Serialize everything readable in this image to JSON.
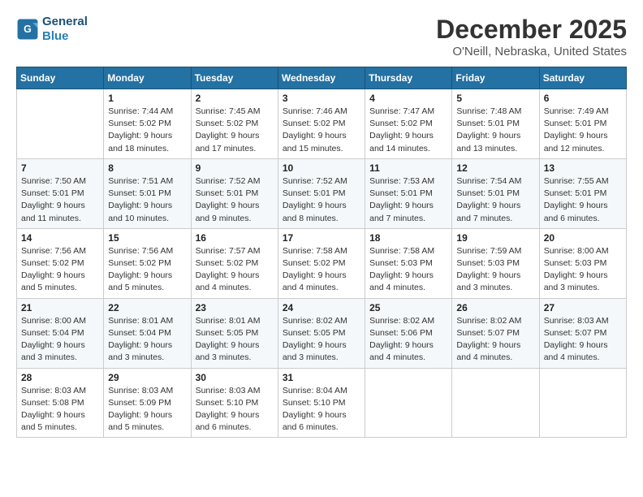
{
  "header": {
    "logo_line1": "General",
    "logo_line2": "Blue",
    "month_title": "December 2025",
    "location": "O'Neill, Nebraska, United States"
  },
  "weekdays": [
    "Sunday",
    "Monday",
    "Tuesday",
    "Wednesday",
    "Thursday",
    "Friday",
    "Saturday"
  ],
  "weeks": [
    [
      {
        "day": "",
        "info": ""
      },
      {
        "day": "1",
        "info": "Sunrise: 7:44 AM\nSunset: 5:02 PM\nDaylight: 9 hours\nand 18 minutes."
      },
      {
        "day": "2",
        "info": "Sunrise: 7:45 AM\nSunset: 5:02 PM\nDaylight: 9 hours\nand 17 minutes."
      },
      {
        "day": "3",
        "info": "Sunrise: 7:46 AM\nSunset: 5:02 PM\nDaylight: 9 hours\nand 15 minutes."
      },
      {
        "day": "4",
        "info": "Sunrise: 7:47 AM\nSunset: 5:02 PM\nDaylight: 9 hours\nand 14 minutes."
      },
      {
        "day": "5",
        "info": "Sunrise: 7:48 AM\nSunset: 5:01 PM\nDaylight: 9 hours\nand 13 minutes."
      },
      {
        "day": "6",
        "info": "Sunrise: 7:49 AM\nSunset: 5:01 PM\nDaylight: 9 hours\nand 12 minutes."
      }
    ],
    [
      {
        "day": "7",
        "info": "Sunrise: 7:50 AM\nSunset: 5:01 PM\nDaylight: 9 hours\nand 11 minutes."
      },
      {
        "day": "8",
        "info": "Sunrise: 7:51 AM\nSunset: 5:01 PM\nDaylight: 9 hours\nand 10 minutes."
      },
      {
        "day": "9",
        "info": "Sunrise: 7:52 AM\nSunset: 5:01 PM\nDaylight: 9 hours\nand 9 minutes."
      },
      {
        "day": "10",
        "info": "Sunrise: 7:52 AM\nSunset: 5:01 PM\nDaylight: 9 hours\nand 8 minutes."
      },
      {
        "day": "11",
        "info": "Sunrise: 7:53 AM\nSunset: 5:01 PM\nDaylight: 9 hours\nand 7 minutes."
      },
      {
        "day": "12",
        "info": "Sunrise: 7:54 AM\nSunset: 5:01 PM\nDaylight: 9 hours\nand 7 minutes."
      },
      {
        "day": "13",
        "info": "Sunrise: 7:55 AM\nSunset: 5:01 PM\nDaylight: 9 hours\nand 6 minutes."
      }
    ],
    [
      {
        "day": "14",
        "info": "Sunrise: 7:56 AM\nSunset: 5:02 PM\nDaylight: 9 hours\nand 5 minutes."
      },
      {
        "day": "15",
        "info": "Sunrise: 7:56 AM\nSunset: 5:02 PM\nDaylight: 9 hours\nand 5 minutes."
      },
      {
        "day": "16",
        "info": "Sunrise: 7:57 AM\nSunset: 5:02 PM\nDaylight: 9 hours\nand 4 minutes."
      },
      {
        "day": "17",
        "info": "Sunrise: 7:58 AM\nSunset: 5:02 PM\nDaylight: 9 hours\nand 4 minutes."
      },
      {
        "day": "18",
        "info": "Sunrise: 7:58 AM\nSunset: 5:03 PM\nDaylight: 9 hours\nand 4 minutes."
      },
      {
        "day": "19",
        "info": "Sunrise: 7:59 AM\nSunset: 5:03 PM\nDaylight: 9 hours\nand 3 minutes."
      },
      {
        "day": "20",
        "info": "Sunrise: 8:00 AM\nSunset: 5:03 PM\nDaylight: 9 hours\nand 3 minutes."
      }
    ],
    [
      {
        "day": "21",
        "info": "Sunrise: 8:00 AM\nSunset: 5:04 PM\nDaylight: 9 hours\nand 3 minutes."
      },
      {
        "day": "22",
        "info": "Sunrise: 8:01 AM\nSunset: 5:04 PM\nDaylight: 9 hours\nand 3 minutes."
      },
      {
        "day": "23",
        "info": "Sunrise: 8:01 AM\nSunset: 5:05 PM\nDaylight: 9 hours\nand 3 minutes."
      },
      {
        "day": "24",
        "info": "Sunrise: 8:02 AM\nSunset: 5:05 PM\nDaylight: 9 hours\nand 3 minutes."
      },
      {
        "day": "25",
        "info": "Sunrise: 8:02 AM\nSunset: 5:06 PM\nDaylight: 9 hours\nand 4 minutes."
      },
      {
        "day": "26",
        "info": "Sunrise: 8:02 AM\nSunset: 5:07 PM\nDaylight: 9 hours\nand 4 minutes."
      },
      {
        "day": "27",
        "info": "Sunrise: 8:03 AM\nSunset: 5:07 PM\nDaylight: 9 hours\nand 4 minutes."
      }
    ],
    [
      {
        "day": "28",
        "info": "Sunrise: 8:03 AM\nSunset: 5:08 PM\nDaylight: 9 hours\nand 5 minutes."
      },
      {
        "day": "29",
        "info": "Sunrise: 8:03 AM\nSunset: 5:09 PM\nDaylight: 9 hours\nand 5 minutes."
      },
      {
        "day": "30",
        "info": "Sunrise: 8:03 AM\nSunset: 5:10 PM\nDaylight: 9 hours\nand 6 minutes."
      },
      {
        "day": "31",
        "info": "Sunrise: 8:04 AM\nSunset: 5:10 PM\nDaylight: 9 hours\nand 6 minutes."
      },
      {
        "day": "",
        "info": ""
      },
      {
        "day": "",
        "info": ""
      },
      {
        "day": "",
        "info": ""
      }
    ]
  ]
}
